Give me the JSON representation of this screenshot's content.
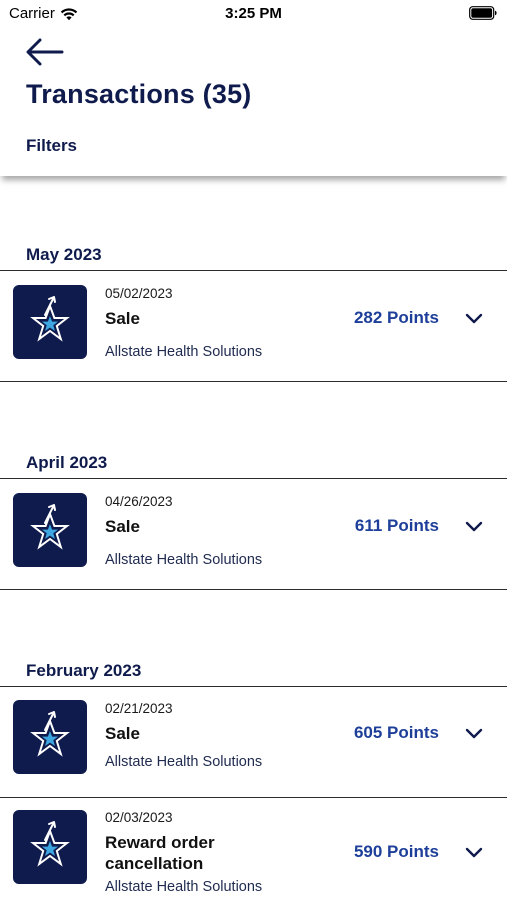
{
  "status_bar": {
    "carrier": "Carrier",
    "time": "3:25 PM"
  },
  "header": {
    "title": "Transactions (35)",
    "filters_label": "Filters"
  },
  "groups": [
    {
      "month": "May 2023",
      "items": [
        {
          "date": "05/02/2023",
          "type": "Sale",
          "points": "282 Points",
          "merchant": "Allstate Health Solutions"
        }
      ]
    },
    {
      "month": "April 2023",
      "items": [
        {
          "date": "04/26/2023",
          "type": "Sale",
          "points": "611 Points",
          "merchant": "Allstate Health Solutions"
        }
      ]
    },
    {
      "month": "February 2023",
      "items": [
        {
          "date": "02/21/2023",
          "type": "Sale",
          "points": "605 Points",
          "merchant": "Allstate Health Solutions"
        },
        {
          "date": "02/03/2023",
          "type_line1": "Reward order",
          "type_line2": "cancellation",
          "points": "590 Points",
          "merchant": "Allstate Health Solutions"
        }
      ]
    }
  ],
  "colors": {
    "navy": "#0f1b4c",
    "points_blue": "#1e3f99",
    "star_blue": "#3ea6e0"
  },
  "icons": [
    "wifi-icon",
    "battery-icon",
    "back-arrow-icon",
    "reward-star-icon",
    "chevron-down-icon"
  ]
}
